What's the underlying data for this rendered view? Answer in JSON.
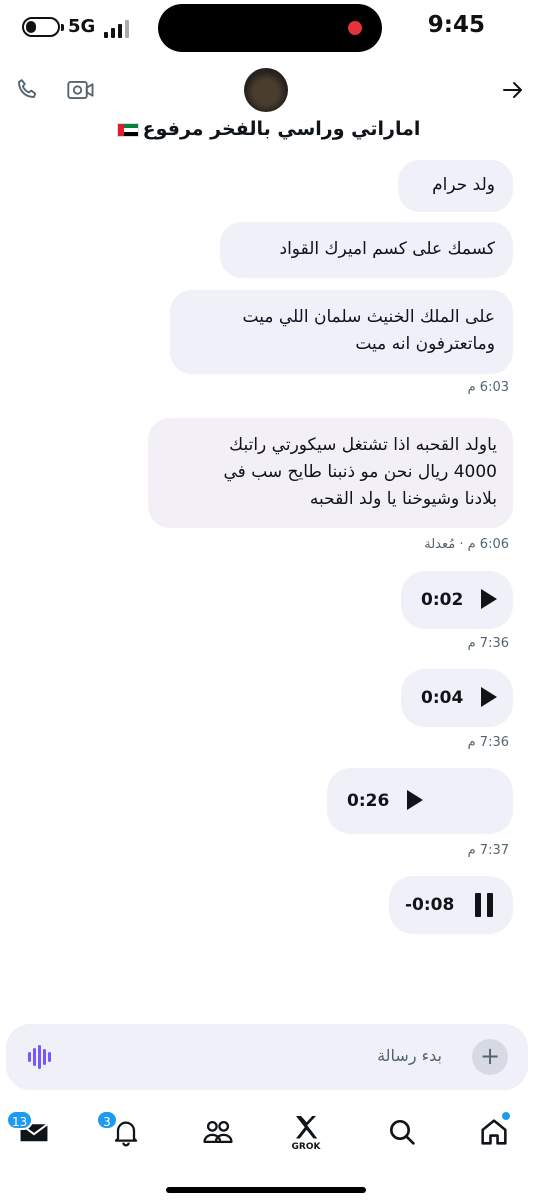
{
  "status_bar": {
    "network": "5G",
    "time": "9:45"
  },
  "header": {
    "title": "اماراتي وراسي بالفخر مرفوع",
    "icons": [
      "phone-icon",
      "video-icon",
      "back-arrow-icon"
    ]
  },
  "messages": [
    {
      "type": "text",
      "text": "ولد حرام"
    },
    {
      "type": "text",
      "text": "كسمك على كسم اميرك القواد"
    },
    {
      "type": "text",
      "lines": [
        "على الملك الخنيث سلمان اللي ميت",
        "وماتعترفون انه ميت"
      ],
      "meta": "6:03 م"
    },
    {
      "type": "text",
      "lines": [
        "ياولد القحبه اذا تشتغل سيكورتي راتبك",
        "4000 ريال نحن مو ذنبنا طايح سب في",
        "بلادنا وشيوخنا يا ولد القحبه"
      ],
      "meta": "6:06 م · مُعدلة"
    },
    {
      "type": "voice",
      "duration": "0:02",
      "state": "play",
      "meta": "7:36 م"
    },
    {
      "type": "voice",
      "duration": "0:04",
      "state": "play",
      "meta": "7:36 م"
    },
    {
      "type": "voice",
      "duration": "0:26",
      "state": "play",
      "meta": "7:37 م"
    },
    {
      "type": "voice",
      "duration": "-0:08",
      "state": "pause"
    }
  ],
  "compose": {
    "placeholder": "بدء رسالة"
  },
  "nav": {
    "messages_badge": "13",
    "notifications_badge": "3",
    "grok_label": "GROK"
  }
}
